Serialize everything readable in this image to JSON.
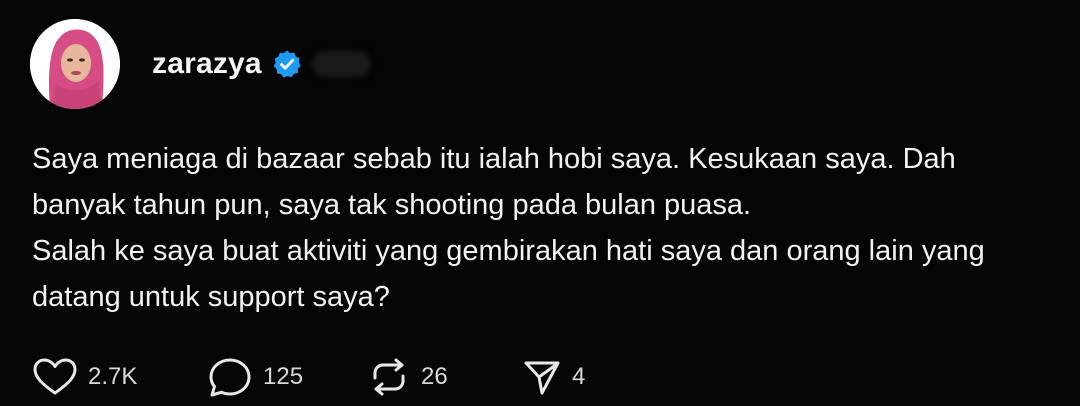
{
  "post": {
    "author": {
      "username": "zarazya",
      "verified": true,
      "avatar_colors": {
        "hijab": "#d64d86",
        "skin": "#e6b79a",
        "background": "#ffffff"
      }
    },
    "paragraphs": [
      "Saya meniaga di bazaar sebab itu ialah hobi saya. Kesukaan saya. Dah banyak tahun pun, saya tak shooting pada bulan puasa.",
      "Salah ke saya buat aktiviti yang gembirakan hati saya dan orang lain yang datang untuk support saya?"
    ],
    "actions": {
      "like": {
        "icon": "heart-icon",
        "count": "2.7K"
      },
      "reply": {
        "icon": "comment-icon",
        "count": "125"
      },
      "repost": {
        "icon": "repost-icon",
        "count": "26"
      },
      "share": {
        "icon": "send-icon",
        "count": "4"
      }
    }
  },
  "theme": {
    "background": "#050505",
    "text": "#f2f2f2",
    "verified_badge": "#1d9bf0"
  }
}
